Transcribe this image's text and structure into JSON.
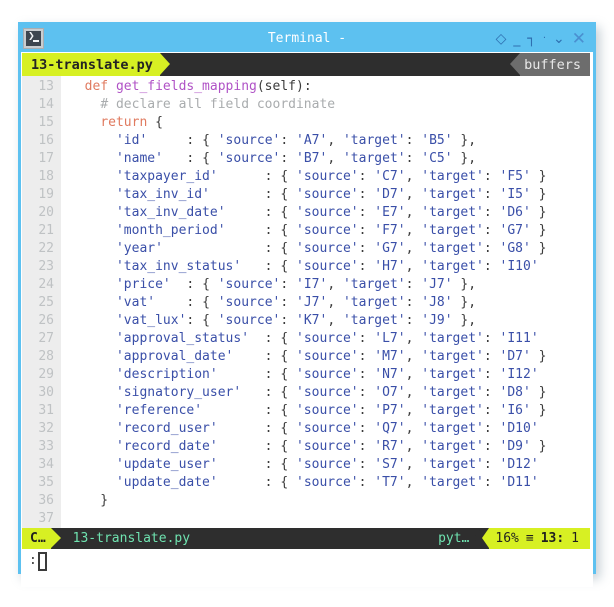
{
  "window": {
    "title": "Terminal -",
    "icon": "terminal-prompt-icon",
    "accent_color": "#5dc1f0",
    "controls": [
      {
        "name": "diamond-icon",
        "glyph": "◇"
      },
      {
        "name": "minimize-icon",
        "glyph": "_"
      },
      {
        "name": "maximize-icon",
        "glyph": "┐"
      },
      {
        "name": "dot-icon",
        "glyph": "·"
      },
      {
        "name": "chevron-down-icon",
        "glyph": "⌄"
      },
      {
        "name": "close-icon",
        "glyph": "✕"
      }
    ]
  },
  "tabline": {
    "active_tab": "13-translate.py",
    "buffers_label": "buffers",
    "tab_bg": "#d7f023",
    "bar_bg": "#2e2e2e"
  },
  "editor": {
    "first_line_number": 13,
    "lines": [
      {
        "num": "13",
        "tokens": [
          {
            "c": "pn",
            "t": "  "
          },
          {
            "c": "k",
            "t": "def"
          },
          {
            "c": "pn",
            "t": " "
          },
          {
            "c": "fn",
            "t": "get_fields_mapping"
          },
          {
            "c": "pn",
            "t": "(self):"
          }
        ]
      },
      {
        "num": "14",
        "tokens": [
          {
            "c": "pn",
            "t": "    "
          },
          {
            "c": "cm",
            "t": "# declare all field coordinate"
          }
        ]
      },
      {
        "num": "15",
        "tokens": [
          {
            "c": "pn",
            "t": "    "
          },
          {
            "c": "k",
            "t": "return"
          },
          {
            "c": "pn",
            "t": " {"
          }
        ]
      },
      {
        "num": "16",
        "tokens": [
          {
            "c": "pn",
            "t": "      "
          },
          {
            "c": "st",
            "t": "'id'"
          },
          {
            "c": "pn",
            "t": "     : { "
          },
          {
            "c": "st",
            "t": "'source'"
          },
          {
            "c": "pn",
            "t": ": "
          },
          {
            "c": "st",
            "t": "'A7'"
          },
          {
            "c": "pn",
            "t": ", "
          },
          {
            "c": "st",
            "t": "'target'"
          },
          {
            "c": "pn",
            "t": ": "
          },
          {
            "c": "st",
            "t": "'B5'"
          },
          {
            "c": "pn",
            "t": " },"
          }
        ]
      },
      {
        "num": "17",
        "tokens": [
          {
            "c": "pn",
            "t": "      "
          },
          {
            "c": "st",
            "t": "'name'"
          },
          {
            "c": "pn",
            "t": "   : { "
          },
          {
            "c": "st",
            "t": "'source'"
          },
          {
            "c": "pn",
            "t": ": "
          },
          {
            "c": "st",
            "t": "'B7'"
          },
          {
            "c": "pn",
            "t": ", "
          },
          {
            "c": "st",
            "t": "'target'"
          },
          {
            "c": "pn",
            "t": ": "
          },
          {
            "c": "st",
            "t": "'C5'"
          },
          {
            "c": "pn",
            "t": " },"
          }
        ]
      },
      {
        "num": "18",
        "tokens": [
          {
            "c": "pn",
            "t": "      "
          },
          {
            "c": "st",
            "t": "'taxpayer_id'"
          },
          {
            "c": "pn",
            "t": "      : { "
          },
          {
            "c": "st",
            "t": "'source'"
          },
          {
            "c": "pn",
            "t": ": "
          },
          {
            "c": "st",
            "t": "'C7'"
          },
          {
            "c": "pn",
            "t": ", "
          },
          {
            "c": "st",
            "t": "'target'"
          },
          {
            "c": "pn",
            "t": ": "
          },
          {
            "c": "st",
            "t": "'F5'"
          },
          {
            "c": "pn",
            "t": " }"
          }
        ]
      },
      {
        "num": "19",
        "tokens": [
          {
            "c": "pn",
            "t": "      "
          },
          {
            "c": "st",
            "t": "'tax_inv_id'"
          },
          {
            "c": "pn",
            "t": "       : { "
          },
          {
            "c": "st",
            "t": "'source'"
          },
          {
            "c": "pn",
            "t": ": "
          },
          {
            "c": "st",
            "t": "'D7'"
          },
          {
            "c": "pn",
            "t": ", "
          },
          {
            "c": "st",
            "t": "'target'"
          },
          {
            "c": "pn",
            "t": ": "
          },
          {
            "c": "st",
            "t": "'I5'"
          },
          {
            "c": "pn",
            "t": " }"
          }
        ]
      },
      {
        "num": "20",
        "tokens": [
          {
            "c": "pn",
            "t": "      "
          },
          {
            "c": "st",
            "t": "'tax_inv_date'"
          },
          {
            "c": "pn",
            "t": "     : { "
          },
          {
            "c": "st",
            "t": "'source'"
          },
          {
            "c": "pn",
            "t": ": "
          },
          {
            "c": "st",
            "t": "'E7'"
          },
          {
            "c": "pn",
            "t": ", "
          },
          {
            "c": "st",
            "t": "'target'"
          },
          {
            "c": "pn",
            "t": ": "
          },
          {
            "c": "st",
            "t": "'D6'"
          },
          {
            "c": "pn",
            "t": " }"
          }
        ]
      },
      {
        "num": "21",
        "tokens": [
          {
            "c": "pn",
            "t": "      "
          },
          {
            "c": "st",
            "t": "'month_period'"
          },
          {
            "c": "pn",
            "t": "     : { "
          },
          {
            "c": "st",
            "t": "'source'"
          },
          {
            "c": "pn",
            "t": ": "
          },
          {
            "c": "st",
            "t": "'F7'"
          },
          {
            "c": "pn",
            "t": ", "
          },
          {
            "c": "st",
            "t": "'target'"
          },
          {
            "c": "pn",
            "t": ": "
          },
          {
            "c": "st",
            "t": "'G7'"
          },
          {
            "c": "pn",
            "t": " }"
          }
        ]
      },
      {
        "num": "22",
        "tokens": [
          {
            "c": "pn",
            "t": "      "
          },
          {
            "c": "st",
            "t": "'year'"
          },
          {
            "c": "pn",
            "t": "             : { "
          },
          {
            "c": "st",
            "t": "'source'"
          },
          {
            "c": "pn",
            "t": ": "
          },
          {
            "c": "st",
            "t": "'G7'"
          },
          {
            "c": "pn",
            "t": ", "
          },
          {
            "c": "st",
            "t": "'target'"
          },
          {
            "c": "pn",
            "t": ": "
          },
          {
            "c": "st",
            "t": "'G8'"
          },
          {
            "c": "pn",
            "t": " }"
          }
        ]
      },
      {
        "num": "23",
        "tokens": [
          {
            "c": "pn",
            "t": "      "
          },
          {
            "c": "st",
            "t": "'tax_inv_status'"
          },
          {
            "c": "pn",
            "t": "   : { "
          },
          {
            "c": "st",
            "t": "'source'"
          },
          {
            "c": "pn",
            "t": ": "
          },
          {
            "c": "st",
            "t": "'H7'"
          },
          {
            "c": "pn",
            "t": ", "
          },
          {
            "c": "st",
            "t": "'target'"
          },
          {
            "c": "pn",
            "t": ": "
          },
          {
            "c": "st",
            "t": "'I10'"
          }
        ]
      },
      {
        "num": "24",
        "tokens": [
          {
            "c": "pn",
            "t": "      "
          },
          {
            "c": "st",
            "t": "'price'"
          },
          {
            "c": "pn",
            "t": "  : { "
          },
          {
            "c": "st",
            "t": "'source'"
          },
          {
            "c": "pn",
            "t": ": "
          },
          {
            "c": "st",
            "t": "'I7'"
          },
          {
            "c": "pn",
            "t": ", "
          },
          {
            "c": "st",
            "t": "'target'"
          },
          {
            "c": "pn",
            "t": ": "
          },
          {
            "c": "st",
            "t": "'J7'"
          },
          {
            "c": "pn",
            "t": " },"
          }
        ]
      },
      {
        "num": "25",
        "tokens": [
          {
            "c": "pn",
            "t": "      "
          },
          {
            "c": "st",
            "t": "'vat'"
          },
          {
            "c": "pn",
            "t": "    : { "
          },
          {
            "c": "st",
            "t": "'source'"
          },
          {
            "c": "pn",
            "t": ": "
          },
          {
            "c": "st",
            "t": "'J7'"
          },
          {
            "c": "pn",
            "t": ", "
          },
          {
            "c": "st",
            "t": "'target'"
          },
          {
            "c": "pn",
            "t": ": "
          },
          {
            "c": "st",
            "t": "'J8'"
          },
          {
            "c": "pn",
            "t": " },"
          }
        ]
      },
      {
        "num": "26",
        "tokens": [
          {
            "c": "pn",
            "t": "      "
          },
          {
            "c": "st",
            "t": "'vat_lux'"
          },
          {
            "c": "pn",
            "t": ": { "
          },
          {
            "c": "st",
            "t": "'source'"
          },
          {
            "c": "pn",
            "t": ": "
          },
          {
            "c": "st",
            "t": "'K7'"
          },
          {
            "c": "pn",
            "t": ", "
          },
          {
            "c": "st",
            "t": "'target'"
          },
          {
            "c": "pn",
            "t": ": "
          },
          {
            "c": "st",
            "t": "'J9'"
          },
          {
            "c": "pn",
            "t": " },"
          }
        ]
      },
      {
        "num": "27",
        "tokens": [
          {
            "c": "pn",
            "t": "      "
          },
          {
            "c": "st",
            "t": "'approval_status'"
          },
          {
            "c": "pn",
            "t": "  : { "
          },
          {
            "c": "st",
            "t": "'source'"
          },
          {
            "c": "pn",
            "t": ": "
          },
          {
            "c": "st",
            "t": "'L7'"
          },
          {
            "c": "pn",
            "t": ", "
          },
          {
            "c": "st",
            "t": "'target'"
          },
          {
            "c": "pn",
            "t": ": "
          },
          {
            "c": "st",
            "t": "'I11'"
          }
        ]
      },
      {
        "num": "28",
        "tokens": [
          {
            "c": "pn",
            "t": "      "
          },
          {
            "c": "st",
            "t": "'approval_date'"
          },
          {
            "c": "pn",
            "t": "    : { "
          },
          {
            "c": "st",
            "t": "'source'"
          },
          {
            "c": "pn",
            "t": ": "
          },
          {
            "c": "st",
            "t": "'M7'"
          },
          {
            "c": "pn",
            "t": ", "
          },
          {
            "c": "st",
            "t": "'target'"
          },
          {
            "c": "pn",
            "t": ": "
          },
          {
            "c": "st",
            "t": "'D7'"
          },
          {
            "c": "pn",
            "t": " }"
          }
        ]
      },
      {
        "num": "29",
        "tokens": [
          {
            "c": "pn",
            "t": "      "
          },
          {
            "c": "st",
            "t": "'description'"
          },
          {
            "c": "pn",
            "t": "      : { "
          },
          {
            "c": "st",
            "t": "'source'"
          },
          {
            "c": "pn",
            "t": ": "
          },
          {
            "c": "st",
            "t": "'N7'"
          },
          {
            "c": "pn",
            "t": ", "
          },
          {
            "c": "st",
            "t": "'target'"
          },
          {
            "c": "pn",
            "t": ": "
          },
          {
            "c": "st",
            "t": "'I12'"
          }
        ]
      },
      {
        "num": "30",
        "tokens": [
          {
            "c": "pn",
            "t": "      "
          },
          {
            "c": "st",
            "t": "'signatory_user'"
          },
          {
            "c": "pn",
            "t": "   : { "
          },
          {
            "c": "st",
            "t": "'source'"
          },
          {
            "c": "pn",
            "t": ": "
          },
          {
            "c": "st",
            "t": "'O7'"
          },
          {
            "c": "pn",
            "t": ", "
          },
          {
            "c": "st",
            "t": "'target'"
          },
          {
            "c": "pn",
            "t": ": "
          },
          {
            "c": "st",
            "t": "'D8'"
          },
          {
            "c": "pn",
            "t": " }"
          }
        ]
      },
      {
        "num": "31",
        "tokens": [
          {
            "c": "pn",
            "t": "      "
          },
          {
            "c": "st",
            "t": "'reference'"
          },
          {
            "c": "pn",
            "t": "        : { "
          },
          {
            "c": "st",
            "t": "'source'"
          },
          {
            "c": "pn",
            "t": ": "
          },
          {
            "c": "st",
            "t": "'P7'"
          },
          {
            "c": "pn",
            "t": ", "
          },
          {
            "c": "st",
            "t": "'target'"
          },
          {
            "c": "pn",
            "t": ": "
          },
          {
            "c": "st",
            "t": "'I6'"
          },
          {
            "c": "pn",
            "t": " }"
          }
        ]
      },
      {
        "num": "32",
        "tokens": [
          {
            "c": "pn",
            "t": "      "
          },
          {
            "c": "st",
            "t": "'record_user'"
          },
          {
            "c": "pn",
            "t": "      : { "
          },
          {
            "c": "st",
            "t": "'source'"
          },
          {
            "c": "pn",
            "t": ": "
          },
          {
            "c": "st",
            "t": "'Q7'"
          },
          {
            "c": "pn",
            "t": ", "
          },
          {
            "c": "st",
            "t": "'target'"
          },
          {
            "c": "pn",
            "t": ": "
          },
          {
            "c": "st",
            "t": "'D10'"
          }
        ]
      },
      {
        "num": "33",
        "tokens": [
          {
            "c": "pn",
            "t": "      "
          },
          {
            "c": "st",
            "t": "'record_date'"
          },
          {
            "c": "pn",
            "t": "      : { "
          },
          {
            "c": "st",
            "t": "'source'"
          },
          {
            "c": "pn",
            "t": ": "
          },
          {
            "c": "st",
            "t": "'R7'"
          },
          {
            "c": "pn",
            "t": ", "
          },
          {
            "c": "st",
            "t": "'target'"
          },
          {
            "c": "pn",
            "t": ": "
          },
          {
            "c": "st",
            "t": "'D9'"
          },
          {
            "c": "pn",
            "t": " }"
          }
        ]
      },
      {
        "num": "34",
        "tokens": [
          {
            "c": "pn",
            "t": "      "
          },
          {
            "c": "st",
            "t": "'update_user'"
          },
          {
            "c": "pn",
            "t": "      : { "
          },
          {
            "c": "st",
            "t": "'source'"
          },
          {
            "c": "pn",
            "t": ": "
          },
          {
            "c": "st",
            "t": "'S7'"
          },
          {
            "c": "pn",
            "t": ", "
          },
          {
            "c": "st",
            "t": "'target'"
          },
          {
            "c": "pn",
            "t": ": "
          },
          {
            "c": "st",
            "t": "'D12'"
          }
        ]
      },
      {
        "num": "35",
        "tokens": [
          {
            "c": "pn",
            "t": "      "
          },
          {
            "c": "st",
            "t": "'update_date'"
          },
          {
            "c": "pn",
            "t": "      : { "
          },
          {
            "c": "st",
            "t": "'source'"
          },
          {
            "c": "pn",
            "t": ": "
          },
          {
            "c": "st",
            "t": "'T7'"
          },
          {
            "c": "pn",
            "t": ", "
          },
          {
            "c": "st",
            "t": "'target'"
          },
          {
            "c": "pn",
            "t": ": "
          },
          {
            "c": "st",
            "t": "'D11'"
          }
        ]
      },
      {
        "num": "36",
        "tokens": [
          {
            "c": "pn",
            "t": "    }"
          }
        ]
      },
      {
        "num": "37",
        "tokens": [
          {
            "c": "pn",
            "t": ""
          }
        ]
      }
    ]
  },
  "statusline": {
    "mode": "C…",
    "filename": "13-translate.py",
    "filetype": "pyt…",
    "percent": "16%",
    "list_icon": "≡",
    "line": "13:",
    "col": "1"
  },
  "command": {
    "prompt": ":",
    "value": ""
  }
}
